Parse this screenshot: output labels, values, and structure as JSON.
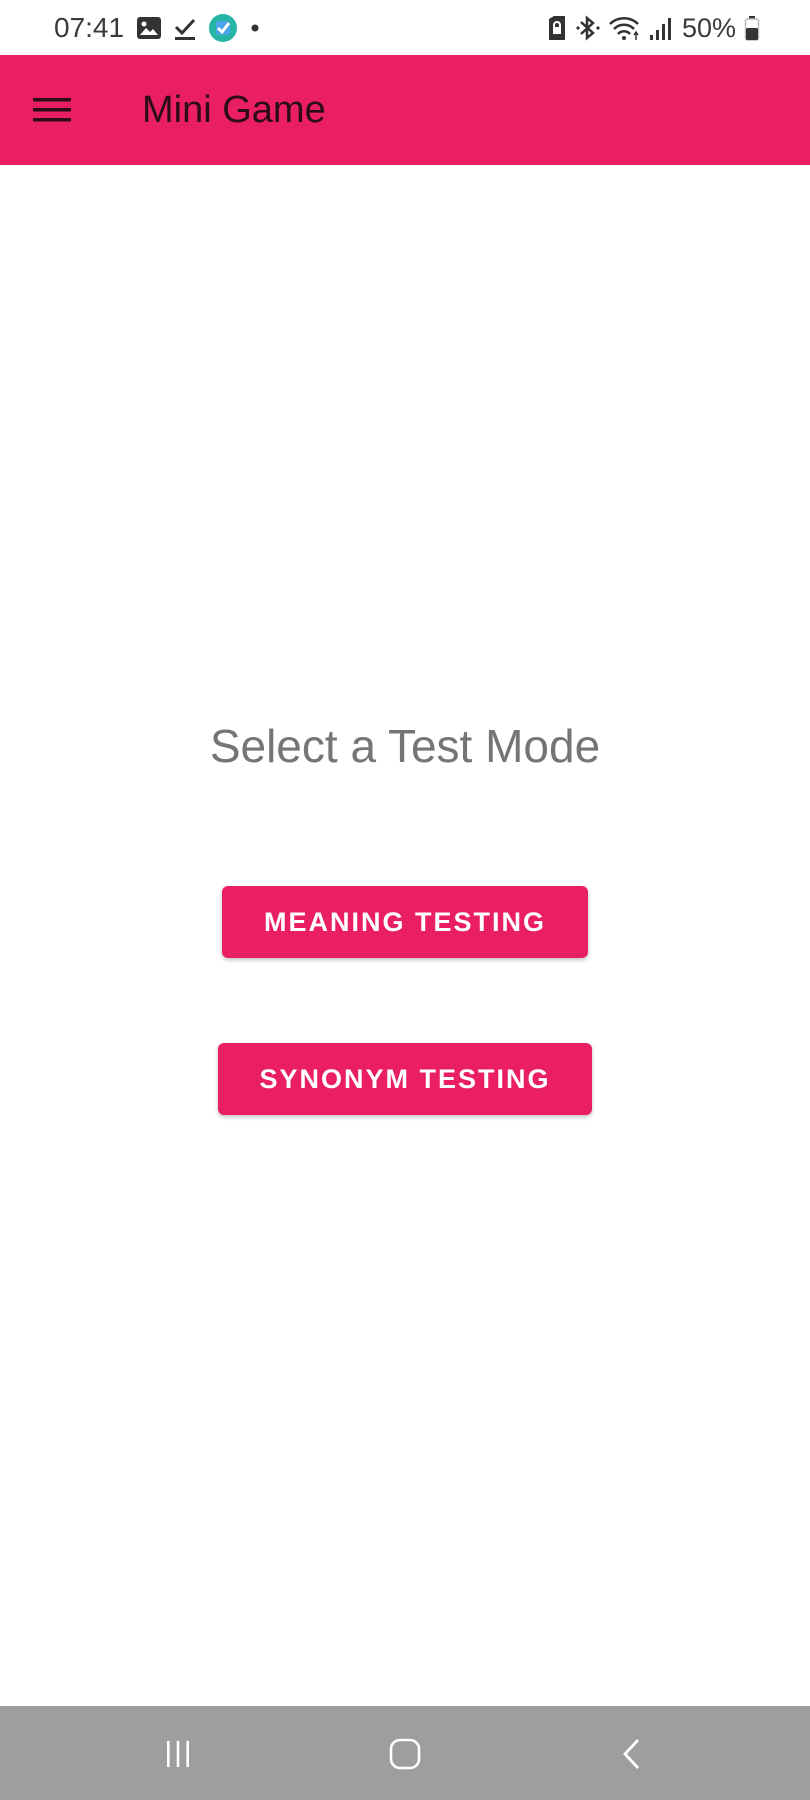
{
  "status_bar": {
    "time": "07:41",
    "left_icons": [
      "image-icon",
      "download-done-icon",
      "check-app-icon",
      "dot-icon"
    ],
    "right_icons": [
      "lock-sim-icon",
      "bluetooth-icon",
      "wifi-icon",
      "signal-icon"
    ],
    "battery_text": "50%",
    "battery_level": 0.5
  },
  "app_bar": {
    "title": "Mini Game",
    "menu_icon": "hamburger-menu-icon",
    "color": "#e91e63"
  },
  "main": {
    "prompt": "Select a Test Mode",
    "buttons": [
      {
        "label": "MEANING TESTING"
      },
      {
        "label": "SYNONYM TESTING"
      }
    ]
  },
  "nav_bar": {
    "recents_icon": "recents-icon",
    "home_icon": "home-icon",
    "back_icon": "back-icon"
  },
  "colors": {
    "accent": "#e91e63",
    "prompt_text": "#757575",
    "nav_bar_bg": "#9e9e9e"
  }
}
